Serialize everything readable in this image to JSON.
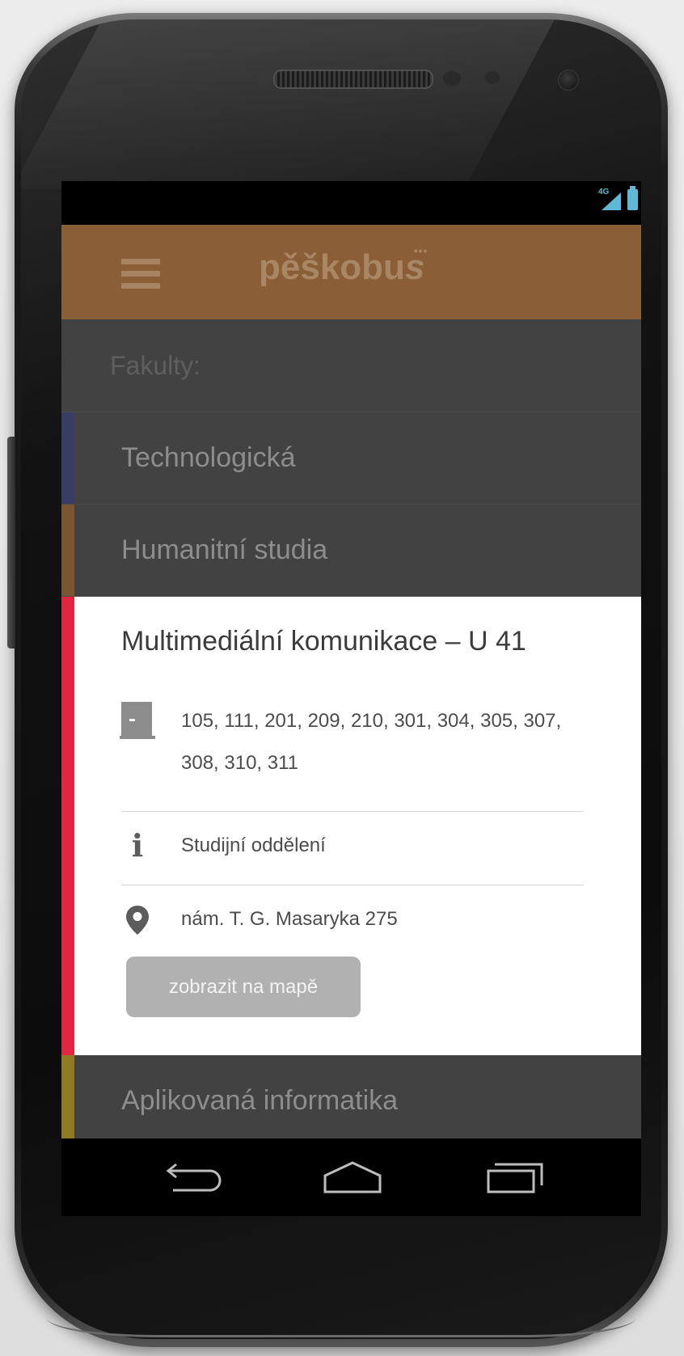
{
  "app": {
    "logo_text": "pěškobu",
    "logo_suffix": "s",
    "logo_dots": "•••"
  },
  "status_bar": {
    "network": "4G",
    "accent_color": "#5fb8d6"
  },
  "list": {
    "section_label": "Fakulty:",
    "faculties": [
      {
        "label": "Technologická",
        "color": "#3a3d63"
      },
      {
        "label": "Humanitní studia",
        "color": "#7a5531"
      },
      {
        "label": "Multimediální komunikace – U 41",
        "color": "#e3263f",
        "rooms": "105, 111, 201, 209, 210, 301, 304, 305, 307, 308, 310, 311",
        "info": "Studijní oddělení",
        "address": "nám. T. G. Masaryka 275",
        "map_button": "zobrazit na mapě"
      },
      {
        "label": "Aplikovaná informatika",
        "color": "#8f7b23"
      }
    ]
  },
  "colors": {
    "app_bar": "#8a5e37",
    "list_background": "#424242"
  },
  "icons": {
    "menu": "hamburger-icon",
    "rooms": "door-icon",
    "info": "info-icon",
    "address": "map-pin-icon",
    "back": "back-icon",
    "home": "home-icon",
    "recents": "recents-icon"
  }
}
